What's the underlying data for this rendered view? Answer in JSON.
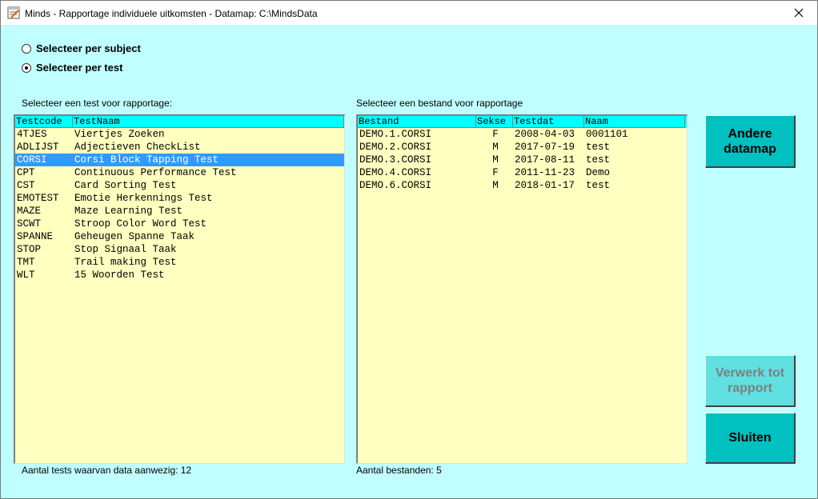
{
  "window": {
    "title": "Minds - Rapportage individuele uitkomsten - Datamap:  C:\\MindsData",
    "close_glyph": "✕"
  },
  "selection_mode": {
    "options": [
      {
        "label": "Selecteer per subject",
        "checked": false
      },
      {
        "label": "Selecteer per test",
        "checked": true
      }
    ]
  },
  "tests_panel": {
    "caption": "Selecteer een test voor rapportage:",
    "headers": [
      "Testcode",
      "TestNaam"
    ],
    "rows": [
      {
        "code": "4TJES",
        "name": "Viertjes Zoeken",
        "selected": false
      },
      {
        "code": "ADLIJST",
        "name": "Adjectieven CheckList",
        "selected": false
      },
      {
        "code": "CORSI",
        "name": "Corsi Block Tapping Test",
        "selected": true
      },
      {
        "code": "CPT",
        "name": "Continuous Performance Test",
        "selected": false
      },
      {
        "code": "CST",
        "name": "Card Sorting Test",
        "selected": false
      },
      {
        "code": "EMOTEST",
        "name": "Emotie Herkennings Test",
        "selected": false
      },
      {
        "code": "MAZE",
        "name": "Maze Learning Test",
        "selected": false
      },
      {
        "code": "SCWT",
        "name": "Stroop Color Word Test",
        "selected": false
      },
      {
        "code": "SPANNE",
        "name": "Geheugen Spanne Taak",
        "selected": false
      },
      {
        "code": "STOP",
        "name": "Stop Signaal Taak",
        "selected": false
      },
      {
        "code": "TMT",
        "name": "Trail making Test",
        "selected": false
      },
      {
        "code": "WLT",
        "name": "15 Woorden Test",
        "selected": false
      }
    ],
    "footer": "Aantal tests waarvan data aanwezig: 12"
  },
  "files_panel": {
    "caption": "Selecteer een bestand voor rapportage",
    "headers": [
      "Bestand",
      "Sekse",
      "Testdat",
      "Naam"
    ],
    "rows": [
      {
        "file": "DEMO.1.CORSI",
        "sex": "F",
        "date": "2008-04-03",
        "name": "0001101"
      },
      {
        "file": "DEMO.2.CORSI",
        "sex": "M",
        "date": "2017-07-19",
        "name": "test"
      },
      {
        "file": "DEMO.3.CORSI",
        "sex": "M",
        "date": "2017-08-11",
        "name": "test"
      },
      {
        "file": "DEMO.4.CORSI",
        "sex": "F",
        "date": "2011-11-23",
        "name": "Demo"
      },
      {
        "file": "DEMO.6.CORSI",
        "sex": "M",
        "date": "2018-01-17",
        "name": "test"
      }
    ],
    "footer": "Aantal bestanden: 5"
  },
  "buttons": {
    "other_datamap": "Andere datamap",
    "process_report": "Verwerk tot rapport",
    "close": "Sluiten"
  },
  "colors": {
    "window_bg": "#c0ffff",
    "list_bg": "#ffffc0",
    "header_bg": "#00ffff",
    "selection": "#3399ff",
    "button": "#00c0c0"
  }
}
